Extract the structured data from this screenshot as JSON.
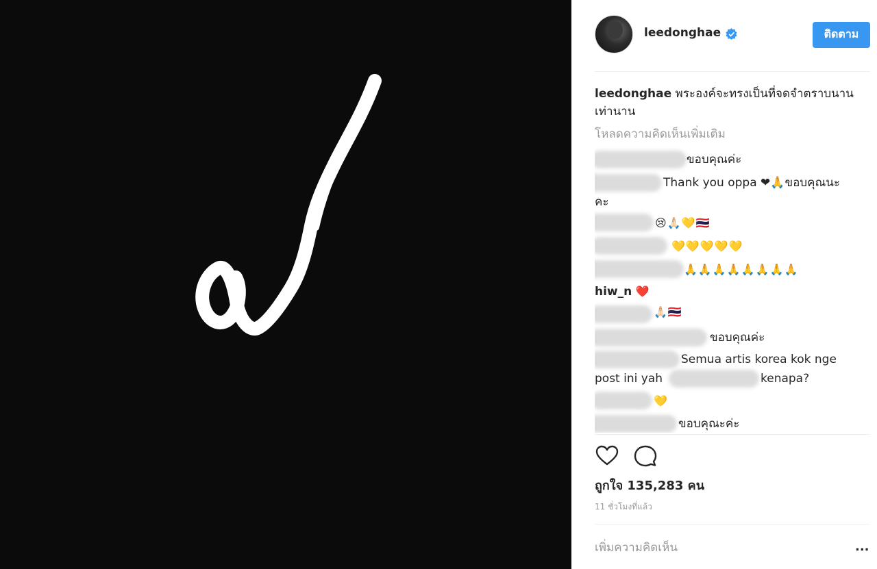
{
  "post": {
    "image_description_icon": "thai-numeral-nine-brush",
    "colors": {
      "accent": "#3897f0",
      "muted": "#999999",
      "media_bg": "#0b0b0b"
    }
  },
  "header": {
    "username": "leedonghae",
    "verified_icon": "verified-badge-icon",
    "follow_label": "ติดตาม"
  },
  "caption": {
    "username": "leedonghae",
    "text": "พระองค์จะทรงเป็นที่จดจำตราบนานเท่านาน"
  },
  "load_more": "โหลดความคิดเห็นเพิ่มเติม",
  "comments": [
    {
      "user": "",
      "text": "ขอบคุณค่ะ"
    },
    {
      "user": "",
      "text": "Thank you oppa ❤🙏ขอบคุณนะ"
    },
    {
      "user": "",
      "text": "คะ"
    },
    {
      "user": "",
      "text": "😢🙏🏻💛🇹🇭"
    },
    {
      "user": "",
      "text": "💛💛💛💛💛"
    },
    {
      "user": "",
      "text": "🙏🙏🙏🙏🙏🙏🙏🙏"
    },
    {
      "user": "hiw_n",
      "text": "❤️"
    },
    {
      "user": "",
      "text": "🙏🏻🇹🇭"
    },
    {
      "user": "",
      "text": "ขอบคุณค่ะ"
    },
    {
      "user": "",
      "text": "Semua artis korea kok nge"
    },
    {
      "user": "",
      "text": "post ini yah"
    },
    {
      "user": "",
      "text": "kenapa?"
    },
    {
      "user": "",
      "text": "💛"
    },
    {
      "user": "",
      "text": "ขอบคุณะค่ะ"
    }
  ],
  "actions": {
    "like_icon": "heart-icon",
    "comment_icon": "comment-bubble-icon"
  },
  "likes": "ถูกใจ 135,283 คน",
  "timestamp": "11 ชั่วโมงที่แล้ว",
  "add_comment_placeholder": "เพิ่มความคิดเห็น",
  "more_options": "..."
}
